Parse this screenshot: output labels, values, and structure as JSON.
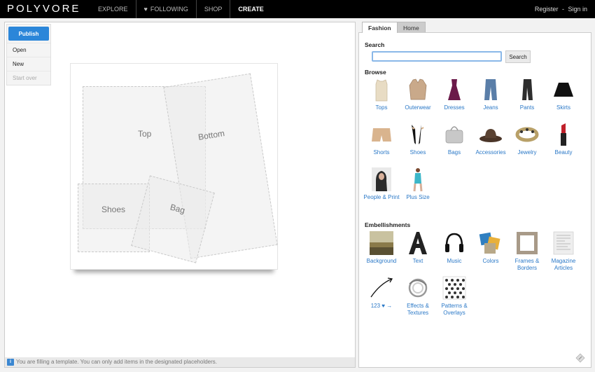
{
  "app": {
    "logo": "POLYVORE",
    "nav": [
      {
        "label": "EXPLORE"
      },
      {
        "label": "FOLLOWING"
      },
      {
        "label": "SHOP"
      },
      {
        "label": "CREATE"
      }
    ],
    "auth": {
      "register": "Register",
      "separator": "-",
      "signin": "Sign in"
    }
  },
  "editor": {
    "publish_label": "Publish",
    "menu": [
      {
        "label": "Open",
        "disabled": false
      },
      {
        "label": "New",
        "disabled": false
      },
      {
        "label": "Start over",
        "disabled": true
      }
    ],
    "placeholders": {
      "top": "Top",
      "bottom": "Bottom",
      "shoes": "Shoes",
      "bag": "Bag"
    },
    "status_text": "You are filling a template. You can only add items in the designated placeholders."
  },
  "sidebar": {
    "tabs": [
      {
        "label": "Fashion",
        "active": true
      },
      {
        "label": "Home",
        "active": false
      }
    ],
    "search_title": "Search",
    "search_value": "",
    "search_button": "Search",
    "browse_title": "Browse",
    "browse": [
      {
        "label": "Tops",
        "icon": "top-icon"
      },
      {
        "label": "Outerwear",
        "icon": "jacket-icon"
      },
      {
        "label": "Dresses",
        "icon": "dress-icon"
      },
      {
        "label": "Jeans",
        "icon": "jeans-icon"
      },
      {
        "label": "Pants",
        "icon": "pants-icon"
      },
      {
        "label": "Skirts",
        "icon": "skirt-icon"
      },
      {
        "label": "Shorts",
        "icon": "shorts-icon"
      },
      {
        "label": "Shoes",
        "icon": "heels-icon"
      },
      {
        "label": "Bags",
        "icon": "handbag-icon"
      },
      {
        "label": "Accessories",
        "icon": "hat-icon"
      },
      {
        "label": "Jewelry",
        "icon": "bracelet-icon"
      },
      {
        "label": "Beauty",
        "icon": "lipstick-icon"
      },
      {
        "label": "People & Print",
        "icon": "person-photo-icon"
      },
      {
        "label": "Plus Size",
        "icon": "swimsuit-model-icon"
      }
    ],
    "embellishments_title": "Embellishments",
    "embellishments": [
      {
        "label": "Background",
        "icon": "landscape-icon"
      },
      {
        "label": "Text",
        "icon": "letter-a-icon"
      },
      {
        "label": "Music",
        "icon": "headphones-icon"
      },
      {
        "label": "Colors",
        "icon": "color-swatches-icon"
      },
      {
        "label": "Frames & Borders",
        "icon": "frame-icon"
      },
      {
        "label": "Magazine Articles",
        "icon": "magazine-icon"
      },
      {
        "label": "123 ♥ →",
        "icon": "arrow-icon"
      },
      {
        "label": "Effects & Textures",
        "icon": "swirl-icon"
      },
      {
        "label": "Patterns & Overlays",
        "icon": "pattern-icon"
      }
    ]
  },
  "colors": {
    "accent": "#2b86d9",
    "link": "#2a78c7",
    "topbar": "#000000"
  }
}
